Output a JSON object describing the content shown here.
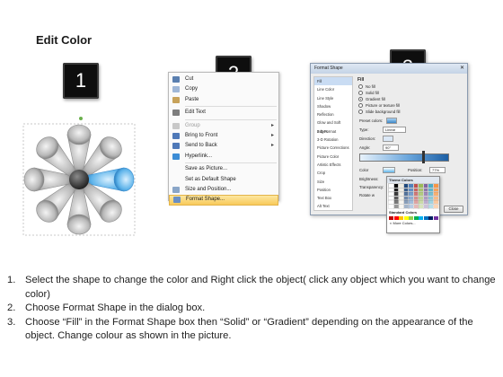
{
  "title": "Edit Color",
  "badges": [
    "1",
    "2",
    "3"
  ],
  "colors": {
    "badge_bg": "#0e0e0e",
    "highlight": "#5fb4ea",
    "petal": "#b4b4b4",
    "menu_highlight": "#f8c95a"
  },
  "context_menu": {
    "items": [
      {
        "label": "Cut",
        "icon": "scissors-icon",
        "enabled": true
      },
      {
        "label": "Copy",
        "icon": "copy-icon",
        "enabled": true
      },
      {
        "label": "Paste",
        "icon": "paste-icon",
        "enabled": true
      },
      {
        "label": "Edit Text",
        "icon": "text-edit-icon",
        "enabled": true
      },
      {
        "label": "Group",
        "icon": "group-icon",
        "enabled": false,
        "submenu": true
      },
      {
        "label": "Bring to Front",
        "icon": "bring-front-icon",
        "enabled": true,
        "submenu": true
      },
      {
        "label": "Send to Back",
        "icon": "send-back-icon",
        "enabled": true,
        "submenu": true
      },
      {
        "label": "Hyperlink...",
        "icon": "hyperlink-icon",
        "enabled": true
      },
      {
        "label": "Save as Picture...",
        "icon": "none",
        "enabled": true
      },
      {
        "label": "Set as Default Shape",
        "icon": "none",
        "enabled": true
      },
      {
        "label": "Size and Position...",
        "icon": "size-icon",
        "enabled": true
      },
      {
        "label": "Format Shape...",
        "icon": "format-shape-icon",
        "enabled": true,
        "highlighted": true
      }
    ]
  },
  "dialog": {
    "title": "Format Shape",
    "categories": [
      "Fill",
      "Line Color",
      "Line Style",
      "Shadow",
      "Reflection",
      "Glow and Soft Edges",
      "3-D Format",
      "3-D Rotation",
      "Picture Corrections",
      "Picture Color",
      "Artistic Effects",
      "Crop",
      "Size",
      "Position",
      "Text Box",
      "Alt Text"
    ],
    "pane_title": "Fill",
    "fill_options": [
      "No fill",
      "Solid fill",
      "Gradient fill",
      "Picture or texture fill",
      "Slide background fill"
    ],
    "selected_fill": "Gradient fill",
    "fields": {
      "preset_colors": "Preset colors:",
      "type": "Type:",
      "type_value": "Linear",
      "direction": "Direction:",
      "angle": "Angle:",
      "angle_value": "90°",
      "gradient_stops": "Gradient stops",
      "color": "Color",
      "position": "Position:",
      "position_value": "77%",
      "brightness": "Brightness:",
      "transparency": "Transparency:",
      "rotate": "Rotate w"
    },
    "close_label": "Close",
    "color_popup": {
      "theme_title": "Theme Colors",
      "standard_title": "Standard Colors",
      "more_colors": "More Colors..."
    }
  },
  "steps": [
    {
      "num": "1.",
      "text": "Select the shape to change the color and Right click the object( click any object which you want to change color)"
    },
    {
      "num": "2.",
      "text": "Choose Format Shape in the dialog box."
    },
    {
      "num": "3.",
      "text": "Choose “Fill” in the Format Shape box then “Solid” or “Gradient” depending on the appearance of the object. Change colour as shown in the picture."
    }
  ]
}
